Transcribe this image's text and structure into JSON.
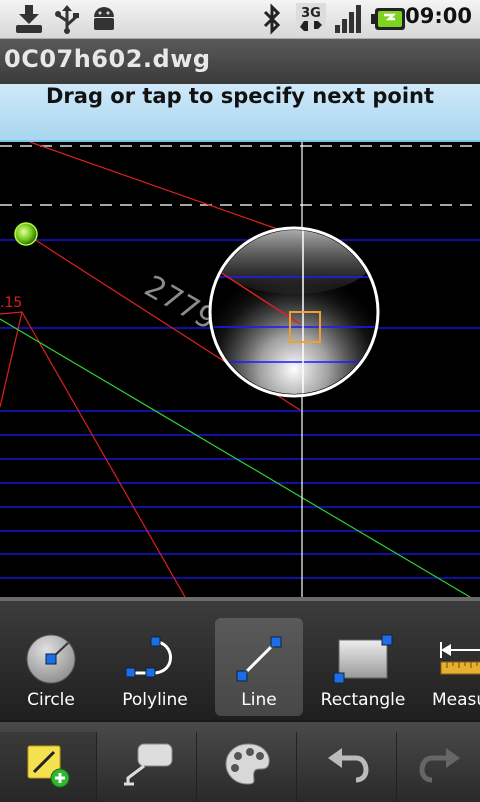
{
  "status_bar": {
    "time": "09:00",
    "network": "3G",
    "icons": [
      "download-icon",
      "usb-icon",
      "android-icon",
      "bluetooth-icon",
      "3g-icon",
      "signal-icon",
      "battery-icon"
    ]
  },
  "title_bar": {
    "filename": "0C07h602.dwg"
  },
  "prompt": {
    "text": "Drag or tap to specify next point"
  },
  "canvas": {
    "dimension_labels": [
      "2779",
      ".15"
    ],
    "colors": {
      "background": "#000000",
      "blue_lines": "#1a1aff",
      "red_lines": "#dd2020",
      "green_line": "#30d030",
      "crosshair": "#ffffff",
      "snap_box": "#f0a030"
    }
  },
  "tools": [
    {
      "label": "Circle",
      "icon": "circle-tool-icon",
      "active": false
    },
    {
      "label": "Polyline",
      "icon": "polyline-tool-icon",
      "active": false
    },
    {
      "label": "Line",
      "icon": "line-tool-icon",
      "active": true
    },
    {
      "label": "Rectangle",
      "icon": "rectangle-tool-icon",
      "active": false
    },
    {
      "label": "Measure",
      "icon": "measure-tool-icon",
      "active": false
    }
  ],
  "bottom_bar": {
    "buttons": [
      "draw-add-icon",
      "annotate-icon",
      "palette-icon",
      "undo-icon",
      "redo-icon"
    ]
  }
}
